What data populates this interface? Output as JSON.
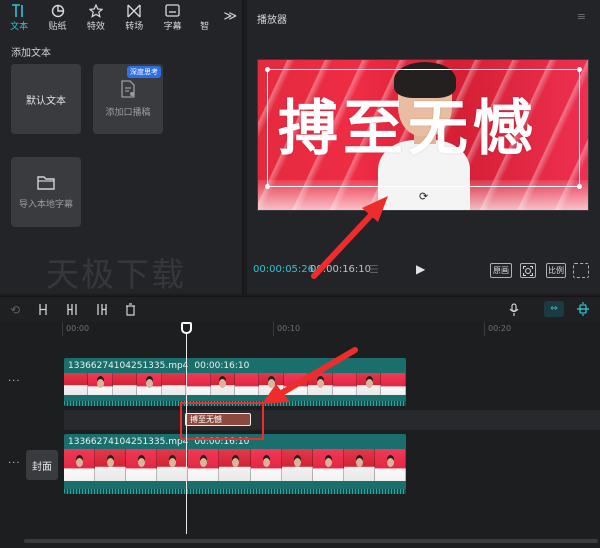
{
  "toolbar": {
    "tools": [
      {
        "label": "文本",
        "icon": "text-icon",
        "active": true
      },
      {
        "label": "贴纸",
        "icon": "sticker-icon",
        "active": false
      },
      {
        "label": "特效",
        "icon": "effects-star-icon",
        "active": false
      },
      {
        "label": "转场",
        "icon": "transition-icon",
        "active": false
      },
      {
        "label": "字幕",
        "icon": "subtitle-icon",
        "active": false
      },
      {
        "label": "智",
        "icon": "smart-icon",
        "active": false
      }
    ],
    "more": "≫"
  },
  "left_panel": {
    "section_title": "添加文本",
    "cards": {
      "default_text": "默认文本",
      "tts_label": "添加口播稿",
      "tts_badge": "深度思考",
      "import_label": "导入本地字幕"
    },
    "watermark": "天极下载"
  },
  "player": {
    "title": "播放器",
    "caption": "搏至无憾",
    "time_current": "00:00:05:26",
    "time_total": "00:00:16:10",
    "buttons": {
      "original": "原画",
      "ratio": "比例"
    }
  },
  "timeline": {
    "ruler": [
      "00:00",
      "00:10",
      "00:20"
    ],
    "cover_label": "封面",
    "clip_top": {
      "name": "13366274104251335.mp4",
      "duration": "00:00:16:10"
    },
    "clip_bottom": {
      "name": "13366274104251335.mp4",
      "duration": "00:00:16:10"
    },
    "text_clip": "搏至无憾",
    "track_more": "···"
  },
  "colors": {
    "accent": "#2cc4d2",
    "annotation": "#ef2c2c",
    "clip": "#1a6f6d",
    "text_clip": "#8c4a3e"
  }
}
